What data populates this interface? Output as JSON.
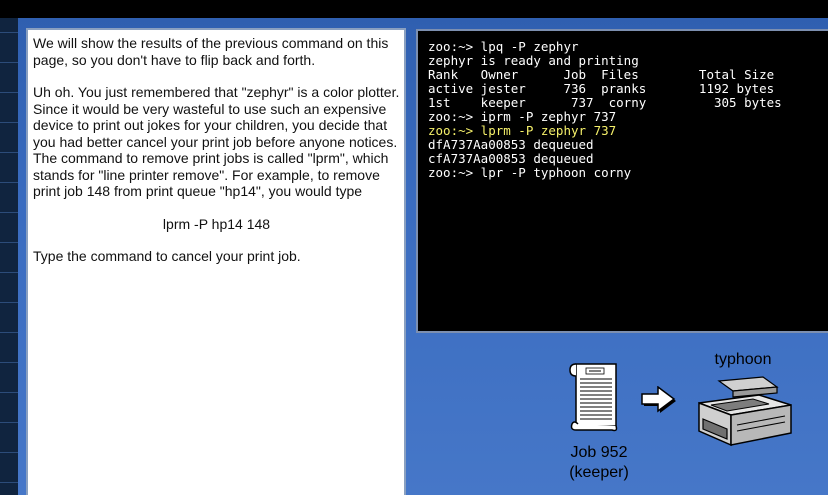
{
  "instructions": {
    "paragraph1": "We will show the results of the previous command on this page, so you don't have to flip back and forth.",
    "paragraph2": "Uh oh. You just remembered that \"zephyr\" is a color plotter. Since it would be very wasteful to use such an expensive device to print out jokes for your children, you decide that you had better cancel your print job before anyone notices. The command to remove print jobs is called \"lprm\", which stands for \"line printer remove\". For example, to remove print job 148 from print queue \"hp14\", you would type",
    "example_command": "lprm -P hp14 148",
    "paragraph3": "Type the command to cancel your print job."
  },
  "terminal": {
    "lines": [
      {
        "text": "zoo:~> lpq -P zephyr",
        "highlight": false
      },
      {
        "text": "zephyr is ready and printing",
        "highlight": false
      },
      {
        "text": "Rank   Owner      Job  Files        Total Size",
        "highlight": false
      },
      {
        "text": "active jester     736  pranks       1192 bytes",
        "highlight": false
      },
      {
        "text": "1st    keeper      737  corny         305 bytes",
        "highlight": false
      },
      {
        "text": "zoo:~> iprm -P zephyr 737",
        "highlight": false
      },
      {
        "text": "zoo:~> lprm -P zephyr 737",
        "highlight": true
      },
      {
        "text": "dfA737Aa00853 dequeued",
        "highlight": false
      },
      {
        "text": "cfA737Aa00853 dequeued",
        "highlight": false
      },
      {
        "text": "zoo:~> lpr -P typhoon corny",
        "highlight": false
      }
    ],
    "highlight_color": "#f5f06a"
  },
  "diagram": {
    "job_label": "Job 952",
    "owner_label": "(keeper)",
    "printer_name": "typhoon",
    "document_icon": "scroll-document-icon",
    "arrow_icon": "right-arrow-icon",
    "printer_icon": "printer-icon"
  }
}
